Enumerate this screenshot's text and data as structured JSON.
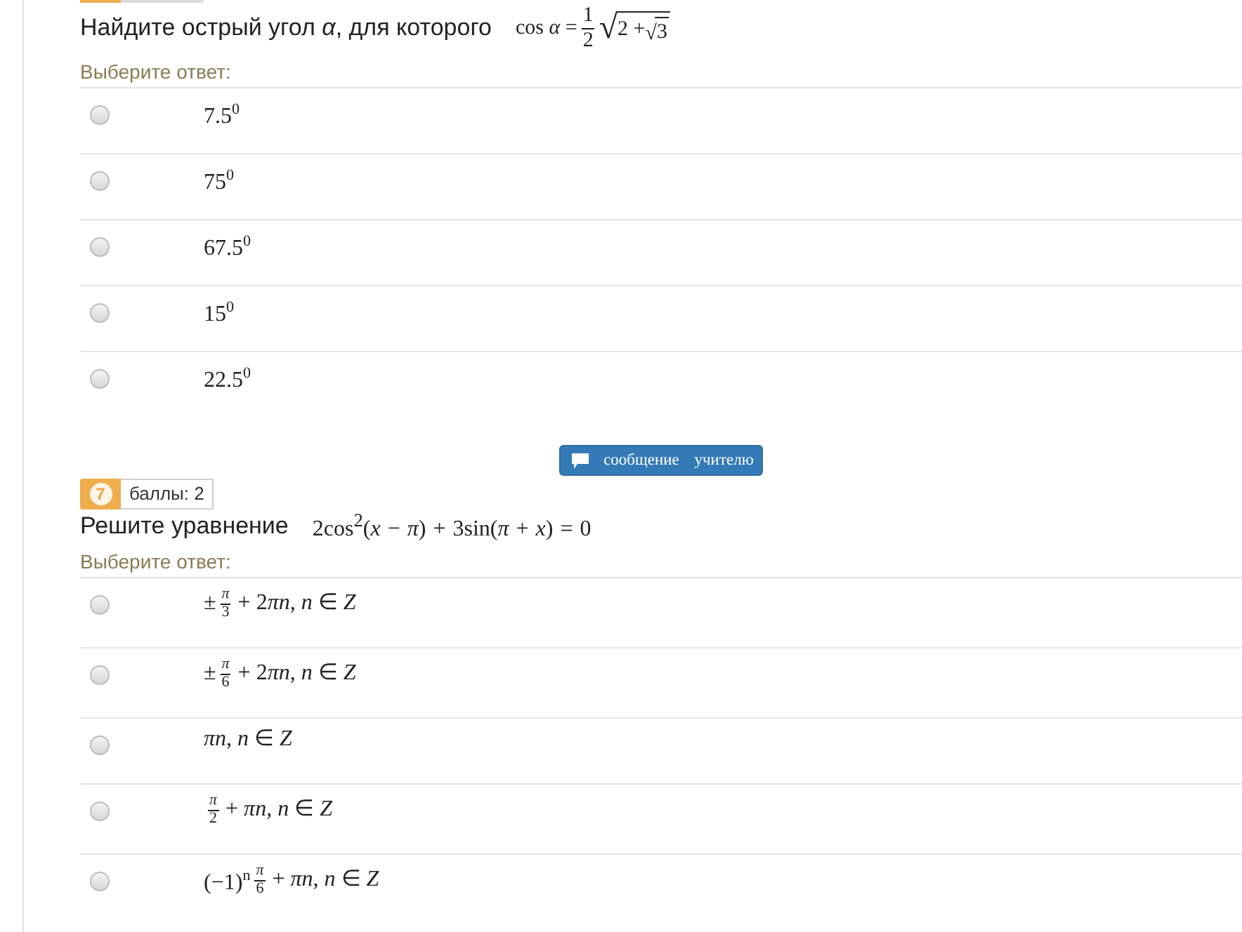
{
  "questions": [
    {
      "prompt": "Найдите острый угол *α*, для которого",
      "formula": [
        {
          "kind": "text",
          "text": "cos *α* ="
        },
        {
          "kind": "frac",
          "num": "1",
          "den": "2"
        },
        {
          "kind": "sqrt",
          "sign": "√",
          "children": [
            {
              "kind": "text",
              "text": "2 +"
            },
            {
              "kind": "sqrt",
              "sign": "√",
              "children": [
                {
                  "kind": "text",
                  "text": "3"
                }
              ]
            }
          ]
        }
      ],
      "answer_prompt": "Выберите ответ:",
      "options": [
        {
          "label": [
            {
              "kind": "text",
              "text": "7.5$^{0}$"
            }
          ],
          "selected": false
        },
        {
          "label": [
            {
              "kind": "text",
              "text": "75$^{0}$"
            }
          ],
          "selected": false
        },
        {
          "label": [
            {
              "kind": "text",
              "text": "67.5$^{0}$"
            }
          ],
          "selected": false
        },
        {
          "label": [
            {
              "kind": "text",
              "text": "15$^{0}$"
            }
          ],
          "selected": false
        },
        {
          "label": [
            {
              "kind": "text",
              "text": "22.5$^{0}$"
            }
          ],
          "selected": false
        }
      ],
      "message_button": {
        "label": "сообщение учителю"
      }
    },
    {
      "number": "7",
      "points": "баллы: 2",
      "prompt": "Решите уравнение",
      "formula": [
        {
          "kind": "text",
          "text": "2cos$^{2}$(*x* − *π*) + 3sin(*π* + *x*) = 0"
        }
      ],
      "answer_prompt": "Выберите ответ:",
      "options": [
        {
          "label": [
            {
              "kind": "text",
              "text": "±"
            },
            {
              "kind": "frac",
              "num": "*π*",
              "den": "3"
            },
            {
              "kind": "text",
              "text": "+ 2"
            },
            {
              "kind": "text",
              "text": "*πn*, *n* ∈ *Z*"
            }
          ],
          "selected": false
        },
        {
          "label": [
            {
              "kind": "text",
              "text": "±"
            },
            {
              "kind": "frac",
              "num": "*π*",
              "den": "6"
            },
            {
              "kind": "text",
              "text": "+ 2"
            },
            {
              "kind": "text",
              "text": "*πn*, *n* ∈ *Z*"
            }
          ],
          "selected": false
        },
        {
          "label": [
            {
              "kind": "text",
              "text": "*πn*, *n* ∈ *Z*"
            }
          ],
          "selected": false
        },
        {
          "label": [
            {
              "kind": "frac",
              "num": "*π*",
              "den": "2"
            },
            {
              "kind": "text",
              "text": "+ *πn*, *n* ∈ *Z*"
            }
          ],
          "selected": false
        },
        {
          "label": [
            {
              "kind": "text",
              "text": "(−1)$^{n}$"
            },
            {
              "kind": "frac",
              "num": "*π*",
              "den": "6"
            },
            {
              "kind": "text",
              "text": "+ *πn*, *n* ∈ *Z*"
            }
          ],
          "selected": false
        }
      ]
    }
  ]
}
